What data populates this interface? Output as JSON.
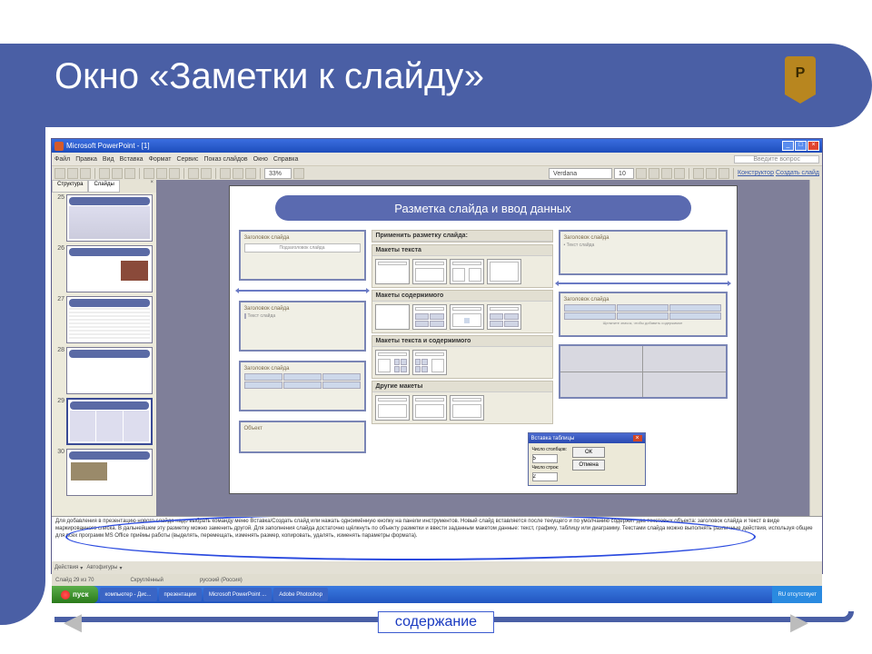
{
  "slide_title": "Окно «Заметки к слайду»",
  "badge": "P",
  "pp": {
    "title": "Microsoft PowerPoint - [1]",
    "menu": [
      "Файл",
      "Правка",
      "Вид",
      "Вставка",
      "Формат",
      "Сервис",
      "Показ слайдов",
      "Окно",
      "Справка"
    ],
    "question_ph": "Введите вопрос",
    "zoom": "33%",
    "font": "Verdana",
    "size": "10",
    "design": "Конструктор",
    "newslide": "Создать слайд",
    "tabs": {
      "outline": "Структура",
      "slides": "Слайды"
    },
    "thumbs": [
      "25",
      "26",
      "27",
      "28",
      "29",
      "30"
    ],
    "inner_title": "Разметка  слайда и ввод данных",
    "apply": "Применить разметку слайда:",
    "sect1": "Макеты текста",
    "sect2": "Макеты содержимого",
    "sect3": "Макеты текста и содержимого",
    "sect4": "Другие макеты",
    "box_labels": {
      "title": "Заголовок слайда",
      "subtitle": "Подзаголовок слайда",
      "text": "Текст слайда",
      "obj": "Объект",
      "click": "Щелкните значок, чтобы добавить содержимое"
    },
    "dlg": {
      "title": "Вставка таблицы",
      "cols": "Число столбцов:",
      "rows": "Число строк:",
      "cols_v": "5",
      "rows_v": "2",
      "ok": "ОК",
      "cancel": "Отмена"
    },
    "notes": "Для добавления в презентацию нового слайда надо выбрать команду меню Вставка/Создать слайд или нажать одноимённую кнопку на панели инструментов. Новый слайд вставляется после текущего и по умолчанию содержит два текстовых объекта: заголовок слайда и текст в виде маркированного списка. В дальнейшем эту разметку можно заменить другой. Для заполнения слайда достаточно щёлкнуть по объекту разметки и ввести заданным макетом данные: текст, графику, таблицу или диаграмму. Текстами слайда можно выполнять различные действия, используя общие для всех программ MS Office приёмы работы (выделять, перемещать, изменять размер, копировать, удалять, изменять параметры формата).",
    "draw": "Действия",
    "autofig": "Автофигуры",
    "status_left": "Слайд 29 из 70",
    "status_mid": "Скруглённый",
    "status_lang": "русский (Россия)",
    "start": "пуск",
    "task_items": [
      "компьютер - Дис...",
      "презентации",
      "Microsoft PowerPoint ...",
      "Adobe Photoshop"
    ],
    "tray": "RU  отсутствует"
  },
  "contents_btn": "содержание"
}
